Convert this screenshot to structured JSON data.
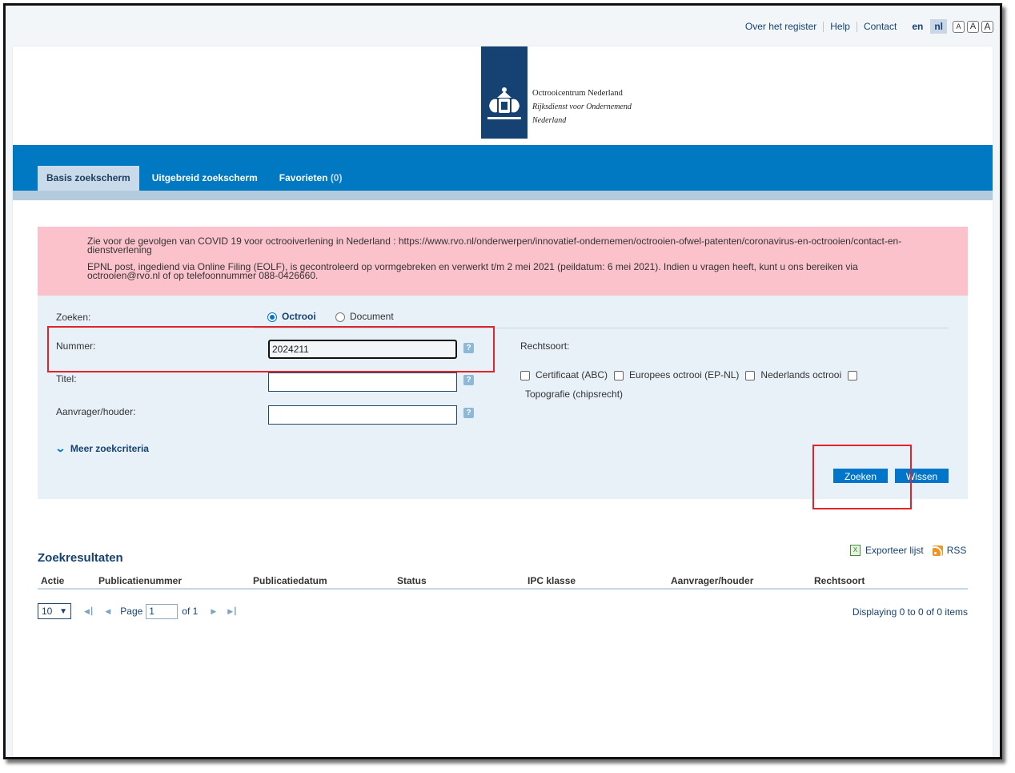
{
  "topnav": {
    "about": "Over het register",
    "help": "Help",
    "contact": "Contact",
    "lang_en": "en",
    "lang_nl": "nl",
    "font_small": "A",
    "font_medium": "A",
    "font_large": "A"
  },
  "logo": {
    "line1": "Octrooicentrum Nederland",
    "line2": "Rijksdienst voor Ondernemend",
    "line3": "Nederland"
  },
  "tabs": {
    "basic": "Basis zoekscherm",
    "advanced": "Uitgebreid zoekscherm",
    "favorites": "Favorieten",
    "favorites_count": "(0)"
  },
  "notice": {
    "p1": "Zie voor de gevolgen van COVID 19 voor octrooiverlening in Nederland : https://www.rvo.nl/onderwerpen/innovatief-ondernemen/octrooien-ofwel-patenten/coronavirus-en-octrooien/contact-en-dienstverlening",
    "p2": "EPNL post, ingediend via Online Filing (EOLF), is gecontroleerd op vormgebreken en verwerkt t/m 2 mei 2021 (peildatum: 6 mei 2021). Indien u vragen heeft, kunt u ons bereiken via octrooien@rvo.nl of op telefoonnummer 088-0426660."
  },
  "form": {
    "search_label": "Zoeken:",
    "radio_patent": "Octrooi",
    "radio_document": "Document",
    "selected_radio": "Octrooi",
    "number_label": "Nummer:",
    "number_value": "2024211",
    "title_label": "Titel:",
    "title_value": "",
    "applicant_label": "Aanvrager/houder:",
    "applicant_value": "",
    "help_glyph": "?",
    "rights_label": "Rechtsoort:",
    "rights": [
      "Certificaat (ABC)",
      "Europees octrooi (EP-NL)",
      "Nederlands octrooi",
      "Topografie (chipsrecht)"
    ],
    "more_criteria": "Meer zoekcriteria",
    "search_button": "Zoeken",
    "clear_button": "Wissen"
  },
  "results": {
    "title": "Zoekresultaten",
    "export": "Exporteer lijst",
    "rss": "RSS",
    "columns": [
      "Actie",
      "Publicatienummer",
      "Publicatiedatum",
      "Status",
      "IPC klasse",
      "Aanvrager/houder",
      "Rechtsoort"
    ],
    "page_size": "10",
    "page_label": "Page",
    "page_value": "1",
    "of_label": "of 1",
    "displaying": "Displaying 0 to 0 of 0 items"
  },
  "colors": {
    "brand_blue": "#0079c2",
    "rijks_blue": "#154273",
    "notice_pink": "#fbc2cc",
    "highlight_red": "#e3232c"
  }
}
